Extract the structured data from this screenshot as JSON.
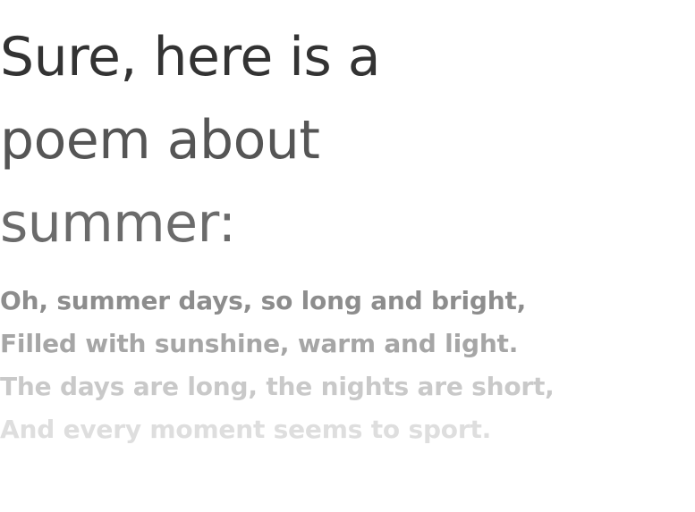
{
  "title": {
    "line1": "Sure, here is a",
    "line2": "poem about",
    "line3": "summer:"
  },
  "poem": {
    "lines": [
      "Oh, summer days, so long and bright,",
      "Filled with sunshine, warm and light.",
      "The days are long, the nights are short,",
      "And every moment seems to sport."
    ]
  },
  "colors": {
    "background": "#ffffff",
    "title_start": "#333333",
    "title_end": "#6b6b6b",
    "poem_start": "#8d8d8d",
    "poem_end": "#dedede"
  }
}
